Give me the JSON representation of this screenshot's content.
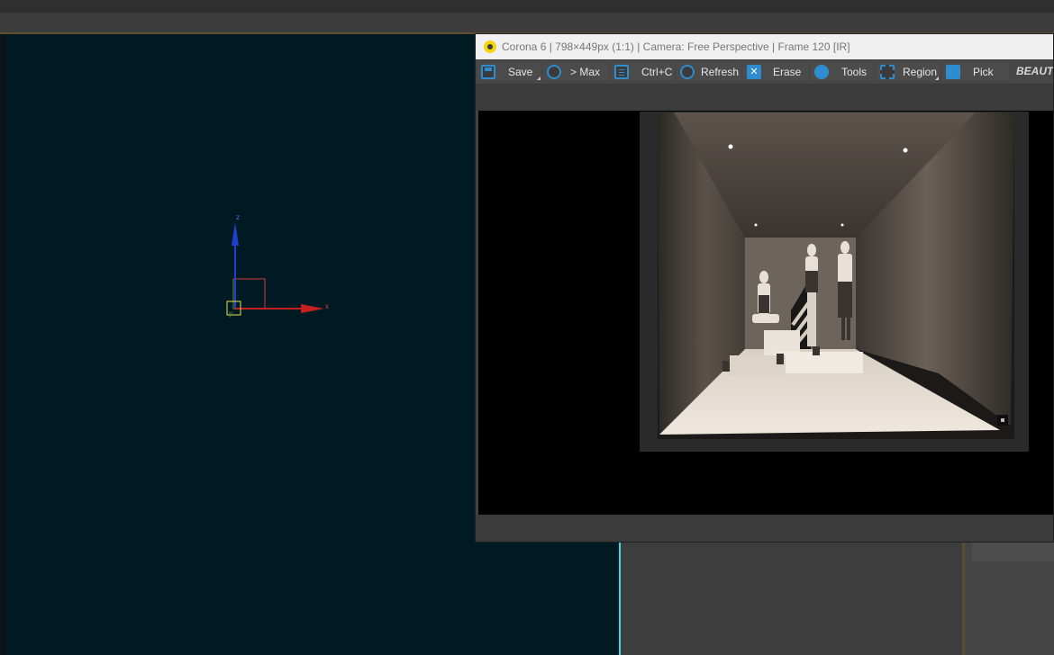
{
  "viewport": {
    "axis_labels": {
      "x": "x",
      "y": "y",
      "z": "z"
    }
  },
  "vfb": {
    "title": "Corona 6 | 798×449px (1:1) | Camera: Free Perspective | Frame 120 [IR]",
    "toolbar": {
      "save": "Save",
      "to_max": "> Max",
      "copy": "Ctrl+C",
      "refresh": "Refresh",
      "erase": "Erase",
      "tools": "Tools",
      "region": "Region",
      "pick": "Pick",
      "render_element": "BEAUTY"
    },
    "icons": {
      "logo": "corona-logo-icon",
      "save": "floppy-disk-icon",
      "to_max": "max-logo-icon",
      "copy": "clipboard-icon",
      "refresh": "refresh-icon",
      "erase": "x-icon",
      "tools": "gear-icon",
      "region": "region-select-icon",
      "pick": "hand-pointer-icon"
    },
    "colors": {
      "accent": "#2e8ccf",
      "logo": "#f2d70c"
    }
  }
}
